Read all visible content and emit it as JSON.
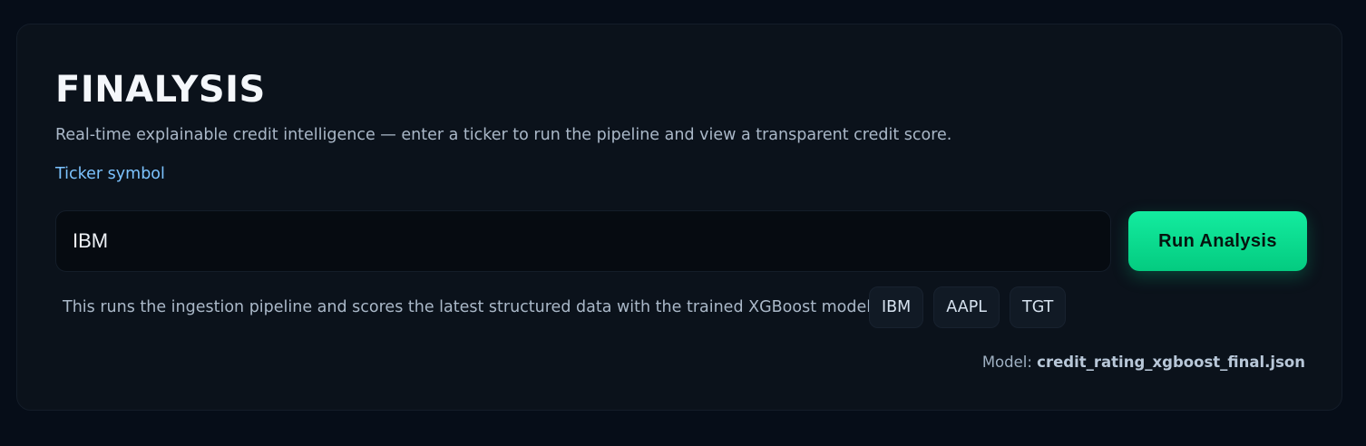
{
  "app": {
    "title": "FINALYSIS",
    "subtitle": "Real-time explainable credit intelligence — enter a ticker to run the pipeline and view a transparent credit score."
  },
  "form": {
    "ticker_label": "Ticker symbol",
    "ticker_value": "IBM",
    "run_button_label": "Run Analysis",
    "helper_text": "This runs the ingestion pipeline and scores the latest structured data with the trained XGBoost model.",
    "quick_tickers": [
      "IBM",
      "AAPL",
      "TGT"
    ]
  },
  "model": {
    "label": "Model:",
    "name": "credit_rating_xgboost_final.json"
  },
  "colors": {
    "background": "#060d18",
    "card": "#0b121b",
    "accent": "#13ec9f",
    "label_blue": "#7cc3ff"
  }
}
